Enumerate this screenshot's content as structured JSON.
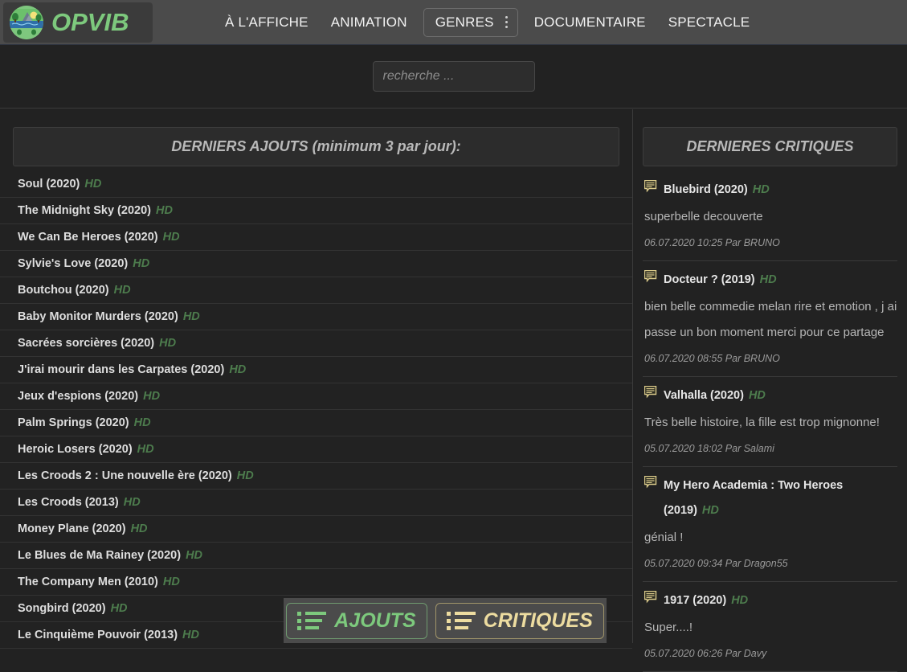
{
  "site": {
    "logo_text": "OPVIB",
    "logo_icon": "landscape-circle-icon",
    "accent_green": "#7dc97d",
    "accent_gold": "#eddca0",
    "hd_green": "#4d7c4d",
    "header_bg": "#4b4b4b",
    "page_bg": "#222222"
  },
  "nav": {
    "items": [
      {
        "label": "À L'AFFICHE",
        "boxed": false
      },
      {
        "label": "ANIMATION",
        "boxed": false
      },
      {
        "label": "GENRES",
        "boxed": true,
        "icon": "kebab-menu-icon"
      },
      {
        "label": "DOCUMENTAIRE",
        "boxed": false
      },
      {
        "label": "SPECTACLE",
        "boxed": false
      }
    ]
  },
  "search": {
    "placeholder": "recherche ...",
    "value": ""
  },
  "ajouts": {
    "header": "DERNIERS AJOUTS (minimum 3 par jour):",
    "quality_label": "HD",
    "items": [
      {
        "title": "Soul (2020)",
        "quality": "HD"
      },
      {
        "title": "The Midnight Sky (2020)",
        "quality": "HD"
      },
      {
        "title": "We Can Be Heroes (2020)",
        "quality": "HD"
      },
      {
        "title": "Sylvie's Love (2020)",
        "quality": "HD"
      },
      {
        "title": "Boutchou (2020)",
        "quality": "HD"
      },
      {
        "title": "Baby Monitor Murders (2020)",
        "quality": "HD"
      },
      {
        "title": "Sacrées sorcières (2020)",
        "quality": "HD"
      },
      {
        "title": "J'irai mourir dans les Carpates (2020)",
        "quality": "HD"
      },
      {
        "title": "Jeux d'espions (2020)",
        "quality": "HD"
      },
      {
        "title": "Palm Springs (2020)",
        "quality": "HD"
      },
      {
        "title": "Heroic Losers (2020)",
        "quality": "HD"
      },
      {
        "title": "Les Croods 2 : Une nouvelle ère (2020)",
        "quality": "HD"
      },
      {
        "title": "Les Croods (2013)",
        "quality": "HD"
      },
      {
        "title": "Money Plane (2020)",
        "quality": "HD"
      },
      {
        "title": "Le Blues de Ma Rainey (2020)",
        "quality": "HD"
      },
      {
        "title": "The Company Men (2010)",
        "quality": "HD"
      },
      {
        "title": "Songbird (2020)",
        "quality": "HD"
      },
      {
        "title": "Le Cinquième Pouvoir (2013)",
        "quality": "HD"
      }
    ]
  },
  "critiques": {
    "header": "DERNIERES CRITIQUES",
    "icon": "comment-bubble-icon",
    "items": [
      {
        "title": "Bluebird (2020)",
        "quality": "HD",
        "body": "superbelle decouverte",
        "meta": "06.07.2020 10:25 Par BRUNO"
      },
      {
        "title": "Docteur ? (2019)",
        "quality": "HD",
        "body": "bien belle commedie melan rire et emotion , j ai passe un bon moment merci pour ce partage",
        "meta": "06.07.2020 08:55 Par BRUNO"
      },
      {
        "title": "Valhalla (2020)",
        "quality": "HD",
        "body": "Très belle histoire, la fille est trop mignonne!",
        "meta": "05.07.2020 18:02 Par Salami"
      },
      {
        "title": "My Hero Academia : Two Heroes (2019)",
        "quality": "HD",
        "body": "génial !",
        "meta": "05.07.2020 09:34 Par Dragon55"
      },
      {
        "title": "1917 (2020)",
        "quality": "HD",
        "body": "Super....!",
        "meta": "05.07.2020 06:26 Par Davy"
      }
    ]
  },
  "bottom_bar": {
    "buttons": [
      {
        "label": "AJOUTS",
        "icon": "list-icon",
        "color": "#7dc97d"
      },
      {
        "label": "CRITIQUES",
        "icon": "list-icon",
        "color": "#eddca0"
      }
    ]
  }
}
